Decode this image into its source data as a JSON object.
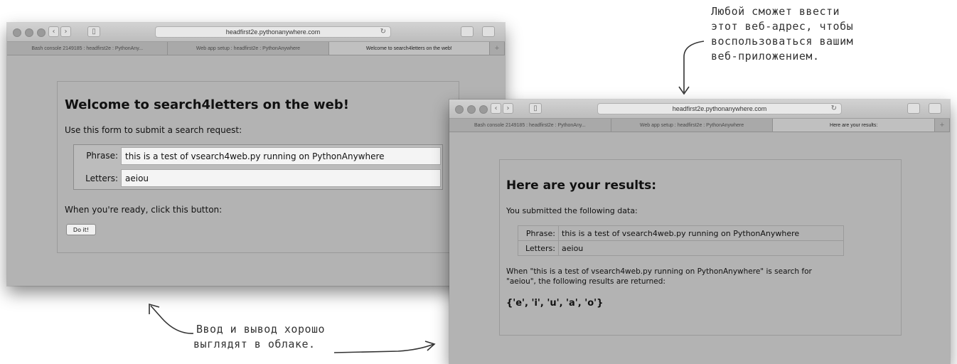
{
  "left_window": {
    "url": "headfirst2e.pythonanywhere.com",
    "tabs": [
      "Bash console 2149185 : headfirst2e : PythonAny...",
      "Web app setup : headfirst2e : PythonAnywhere",
      "Welcome to search4letters on the web!"
    ],
    "heading": "Welcome to search4letters on the web!",
    "intro": "Use this form to submit a search request:",
    "phrase_label": "Phrase:",
    "phrase_value": "this is a test of vsearch4web.py running on PythonAnywhere",
    "letters_label": "Letters:",
    "letters_value": "aeiou",
    "ready_text": "When you're ready, click this button:",
    "button_label": "Do it!"
  },
  "right_window": {
    "url": "headfirst2e.pythonanywhere.com",
    "tabs": [
      "Bash console 2149185 : headfirst2e : PythonAny...",
      "Web app setup : headfirst2e : PythonAnywhere",
      "Here are your results:"
    ],
    "heading": "Here are your results:",
    "intro": "You submitted the following data:",
    "phrase_label": "Phrase:",
    "phrase_value": "this is a test of vsearch4web.py running on PythonAnywhere",
    "letters_label": "Letters:",
    "letters_value": "aeiou",
    "result_line1": "When \"this is a test of vsearch4web.py running on PythonAnywhere\" is search for",
    "result_line2": "\"aeiou\", the following results are returned:",
    "result_value": "{'e', 'i', 'u', 'a', 'o'}"
  },
  "annotations": {
    "top_right": [
      "Любой сможет ввести",
      "этот веб-адрес, чтобы",
      "воспользоваться вашим",
      "веб-приложением."
    ],
    "bottom": [
      "Ввод и вывод хорошо",
      "выглядят в облаке."
    ]
  },
  "icons": {
    "back": "chevron-left-icon",
    "forward": "chevron-right-icon",
    "sidebar": "sidebar-icon",
    "reload": "reload-icon",
    "share": "share-icon",
    "tabs": "tabs-overview-icon"
  }
}
